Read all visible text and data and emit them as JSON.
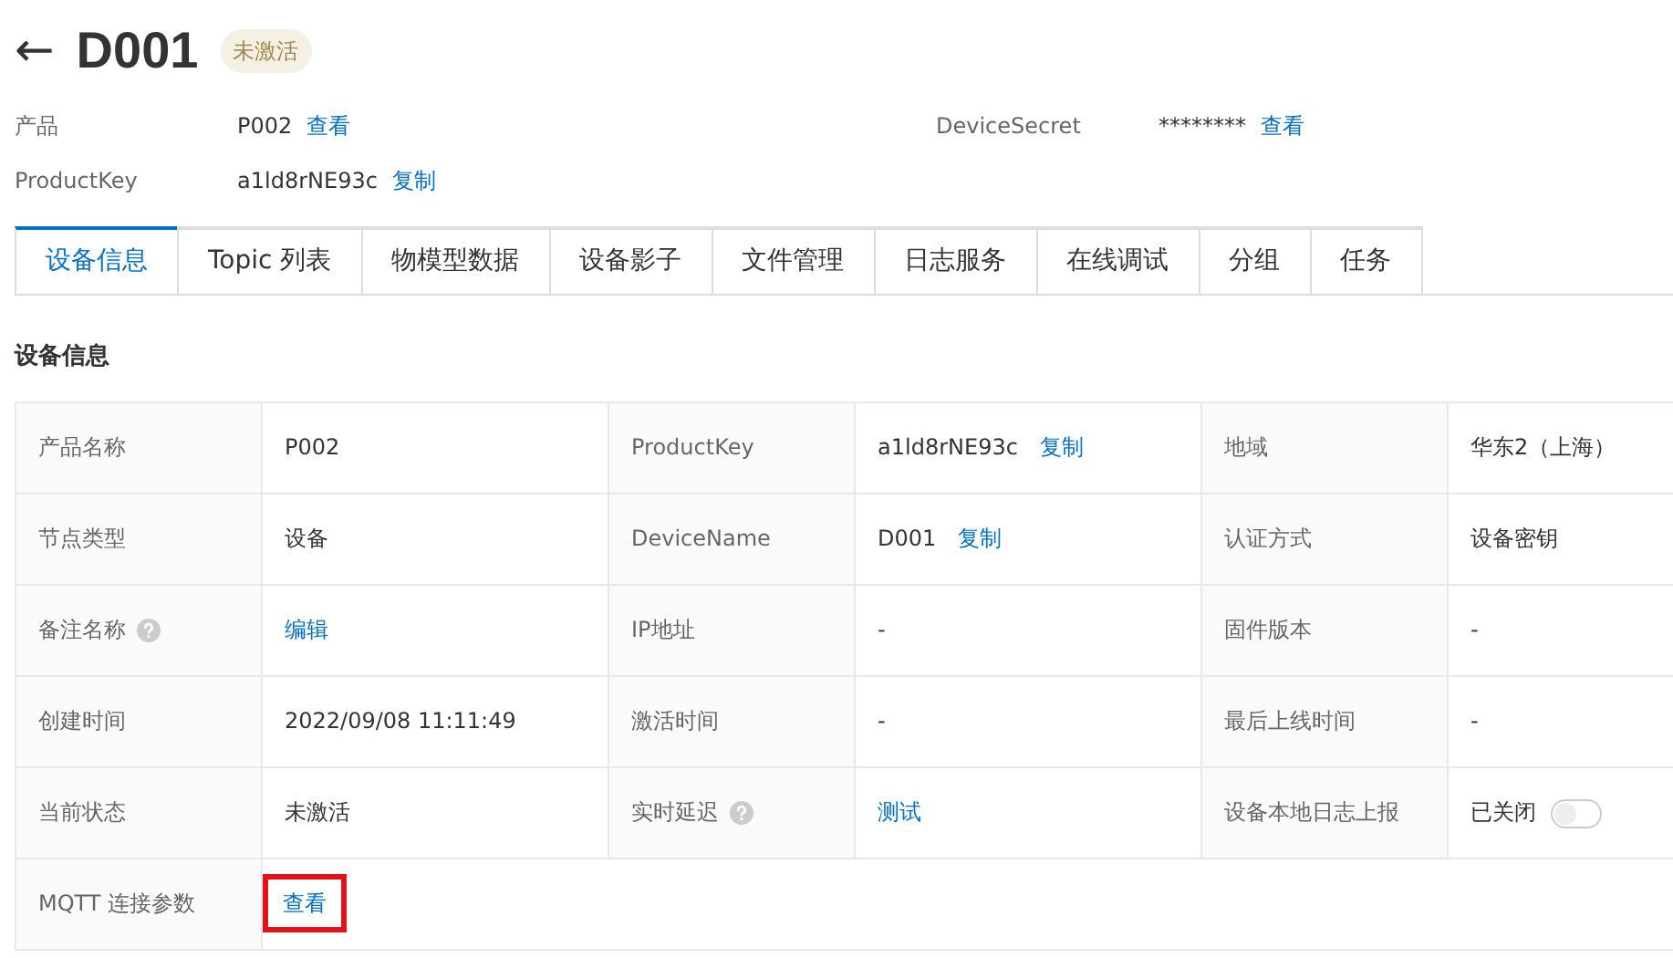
{
  "header": {
    "back": "←",
    "title": "D001",
    "status_badge": "未激活"
  },
  "meta": [
    {
      "label": "产品",
      "value": "P002",
      "action": "查看"
    },
    {
      "label": "DeviceSecret",
      "value": "********",
      "action": "查看"
    },
    {
      "label": "ProductKey",
      "value": "a1ld8rNE93c",
      "action": "复制"
    }
  ],
  "tabs": [
    {
      "label": "设备信息",
      "selected": true
    },
    {
      "label": "Topic 列表",
      "selected": false
    },
    {
      "label": "物模型数据",
      "selected": false
    },
    {
      "label": "设备影子",
      "selected": false
    },
    {
      "label": "文件管理",
      "selected": false
    },
    {
      "label": "日志服务",
      "selected": false
    },
    {
      "label": "在线调试",
      "selected": false
    },
    {
      "label": "分组",
      "selected": false
    },
    {
      "label": "任务",
      "selected": false
    }
  ],
  "section_title": "设备信息",
  "table": {
    "rows": [
      [
        {
          "kind": "label",
          "text": "产品名称"
        },
        {
          "kind": "value",
          "text": "P002"
        },
        {
          "kind": "label",
          "text": "ProductKey"
        },
        {
          "kind": "value",
          "text": "a1ld8rNE93c",
          "action": "复制"
        },
        {
          "kind": "label",
          "text": "地域"
        },
        {
          "kind": "value",
          "text": "华东2（上海）"
        }
      ],
      [
        {
          "kind": "label",
          "text": "节点类型"
        },
        {
          "kind": "value",
          "text": "设备"
        },
        {
          "kind": "label",
          "text": "DeviceName"
        },
        {
          "kind": "value",
          "text": "D001",
          "action": "复制"
        },
        {
          "kind": "label",
          "text": "认证方式"
        },
        {
          "kind": "value",
          "text": "设备密钥"
        }
      ],
      [
        {
          "kind": "label",
          "text": "备注名称",
          "help": true
        },
        {
          "kind": "link",
          "text": "编辑"
        },
        {
          "kind": "label",
          "text": "IP地址"
        },
        {
          "kind": "value",
          "text": "-"
        },
        {
          "kind": "label",
          "text": "固件版本"
        },
        {
          "kind": "value",
          "text": "-"
        }
      ],
      [
        {
          "kind": "label",
          "text": "创建时间"
        },
        {
          "kind": "value",
          "text": "2022/09/08 11:11:49"
        },
        {
          "kind": "label",
          "text": "激活时间"
        },
        {
          "kind": "value",
          "text": "-"
        },
        {
          "kind": "label",
          "text": "最后上线时间"
        },
        {
          "kind": "value",
          "text": "-"
        }
      ],
      [
        {
          "kind": "label",
          "text": "当前状态"
        },
        {
          "kind": "value",
          "text": "未激活"
        },
        {
          "kind": "label",
          "text": "实时延迟",
          "help": true
        },
        {
          "kind": "link",
          "text": "测试"
        },
        {
          "kind": "label",
          "text": "设备本地日志上报"
        },
        {
          "kind": "toggle",
          "text": "已关闭",
          "on": false
        }
      ],
      [
        {
          "kind": "label",
          "text": "MQTT 连接参数"
        },
        {
          "kind": "link",
          "text": "查看",
          "highlighted": true,
          "colspan": 5
        }
      ]
    ]
  }
}
